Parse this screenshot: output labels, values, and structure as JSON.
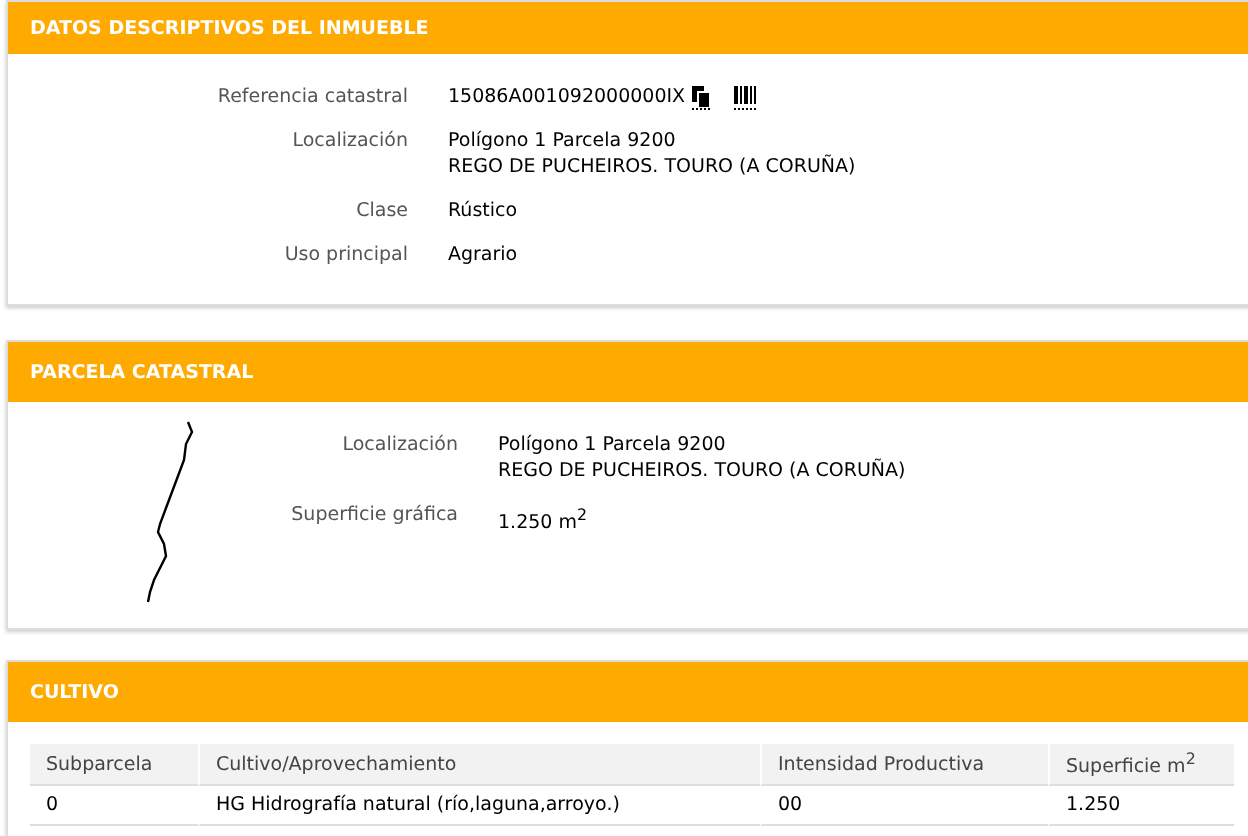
{
  "inmueble": {
    "title": "DATOS DESCRIPTIVOS DEL INMUEBLE",
    "fields": [
      {
        "kind": "ref",
        "label": "Referencia catastral",
        "lines": [
          "15086A001092000000IX"
        ]
      },
      {
        "kind": "text",
        "label": "Localización",
        "lines": [
          "Polígono 1 Parcela 9200",
          "REGO DE PUCHEIROS. TOURO (A CORUÑA)"
        ]
      },
      {
        "kind": "text",
        "label": "Clase",
        "lines": [
          "Rústico"
        ]
      },
      {
        "kind": "text",
        "label": "Uso principal",
        "lines": [
          "Agrario"
        ]
      }
    ]
  },
  "parcela": {
    "title": "PARCELA CATASTRAL",
    "fields": [
      {
        "label": "Localización",
        "lines": [
          "Polígono 1 Parcela 9200",
          "REGO DE PUCHEIROS. TOURO (A CORUÑA)"
        ]
      },
      {
        "label": "Superficie gráfica",
        "lines": [
          "1.250 m$^{2}$"
        ]
      }
    ]
  },
  "cultivo": {
    "title": "CULTIVO",
    "columns": [
      "Subparcela",
      "Cultivo/Aprovechamiento",
      "Intensidad Productiva",
      "Superficie m$^{2}$"
    ],
    "rows": [
      [
        "0",
        "HG Hidrografía natural (río,laguna,arroyo.)",
        "00",
        "1.250"
      ]
    ]
  }
}
